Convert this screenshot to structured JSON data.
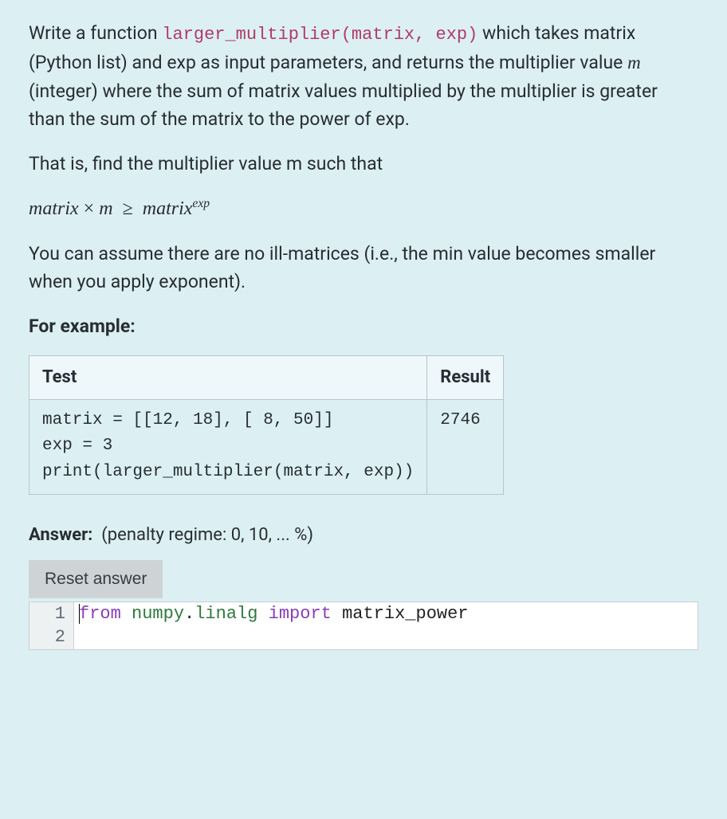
{
  "question": {
    "intro_prefix": "Write a function ",
    "func_signature": "larger_multiplier(matrix, exp)",
    "intro_suffix": " which takes matrix (Python list) and exp as input parameters, and returns the multiplier value ",
    "m_var": "m",
    "intro_cont": " (integer) where the sum of matrix values multiplied by the multiplier is greater than the sum of the matrix to the power of exp.",
    "para2": "That is, find the multiplier value m such that",
    "math": {
      "lhs1": "matrix",
      "times": "×",
      "mvar": "m",
      "ge": "≥",
      "rhs_base": "matrix",
      "rhs_exp": "exp"
    },
    "para3": "You can assume there are no ill-matrices (i.e., the min value becomes smaller when you apply exponent).",
    "example_heading": "For example:"
  },
  "table": {
    "headers": {
      "test": "Test",
      "result": "Result"
    },
    "rows": [
      {
        "test": "matrix = [[12, 18], [ 8, 50]]\nexp = 3\nprint(larger_multiplier(matrix, exp))",
        "result": "2746"
      }
    ]
  },
  "answer": {
    "label": "Answer:",
    "penalty": "(penalty regime: 0, 10, ... %)",
    "reset_label": "Reset answer"
  },
  "code": {
    "lines": [
      {
        "num": "1",
        "tokens": [
          {
            "cls": "tok-kw",
            "t": "from"
          },
          {
            "cls": "tok-plain",
            "t": " "
          },
          {
            "cls": "tok-mod",
            "t": "numpy"
          },
          {
            "cls": "tok-plain",
            "t": "."
          },
          {
            "cls": "tok-sub",
            "t": "linalg"
          },
          {
            "cls": "tok-plain",
            "t": " "
          },
          {
            "cls": "tok-kw",
            "t": "import"
          },
          {
            "cls": "tok-plain",
            "t": " matrix_power"
          }
        ]
      },
      {
        "num": "2",
        "tokens": []
      }
    ]
  }
}
